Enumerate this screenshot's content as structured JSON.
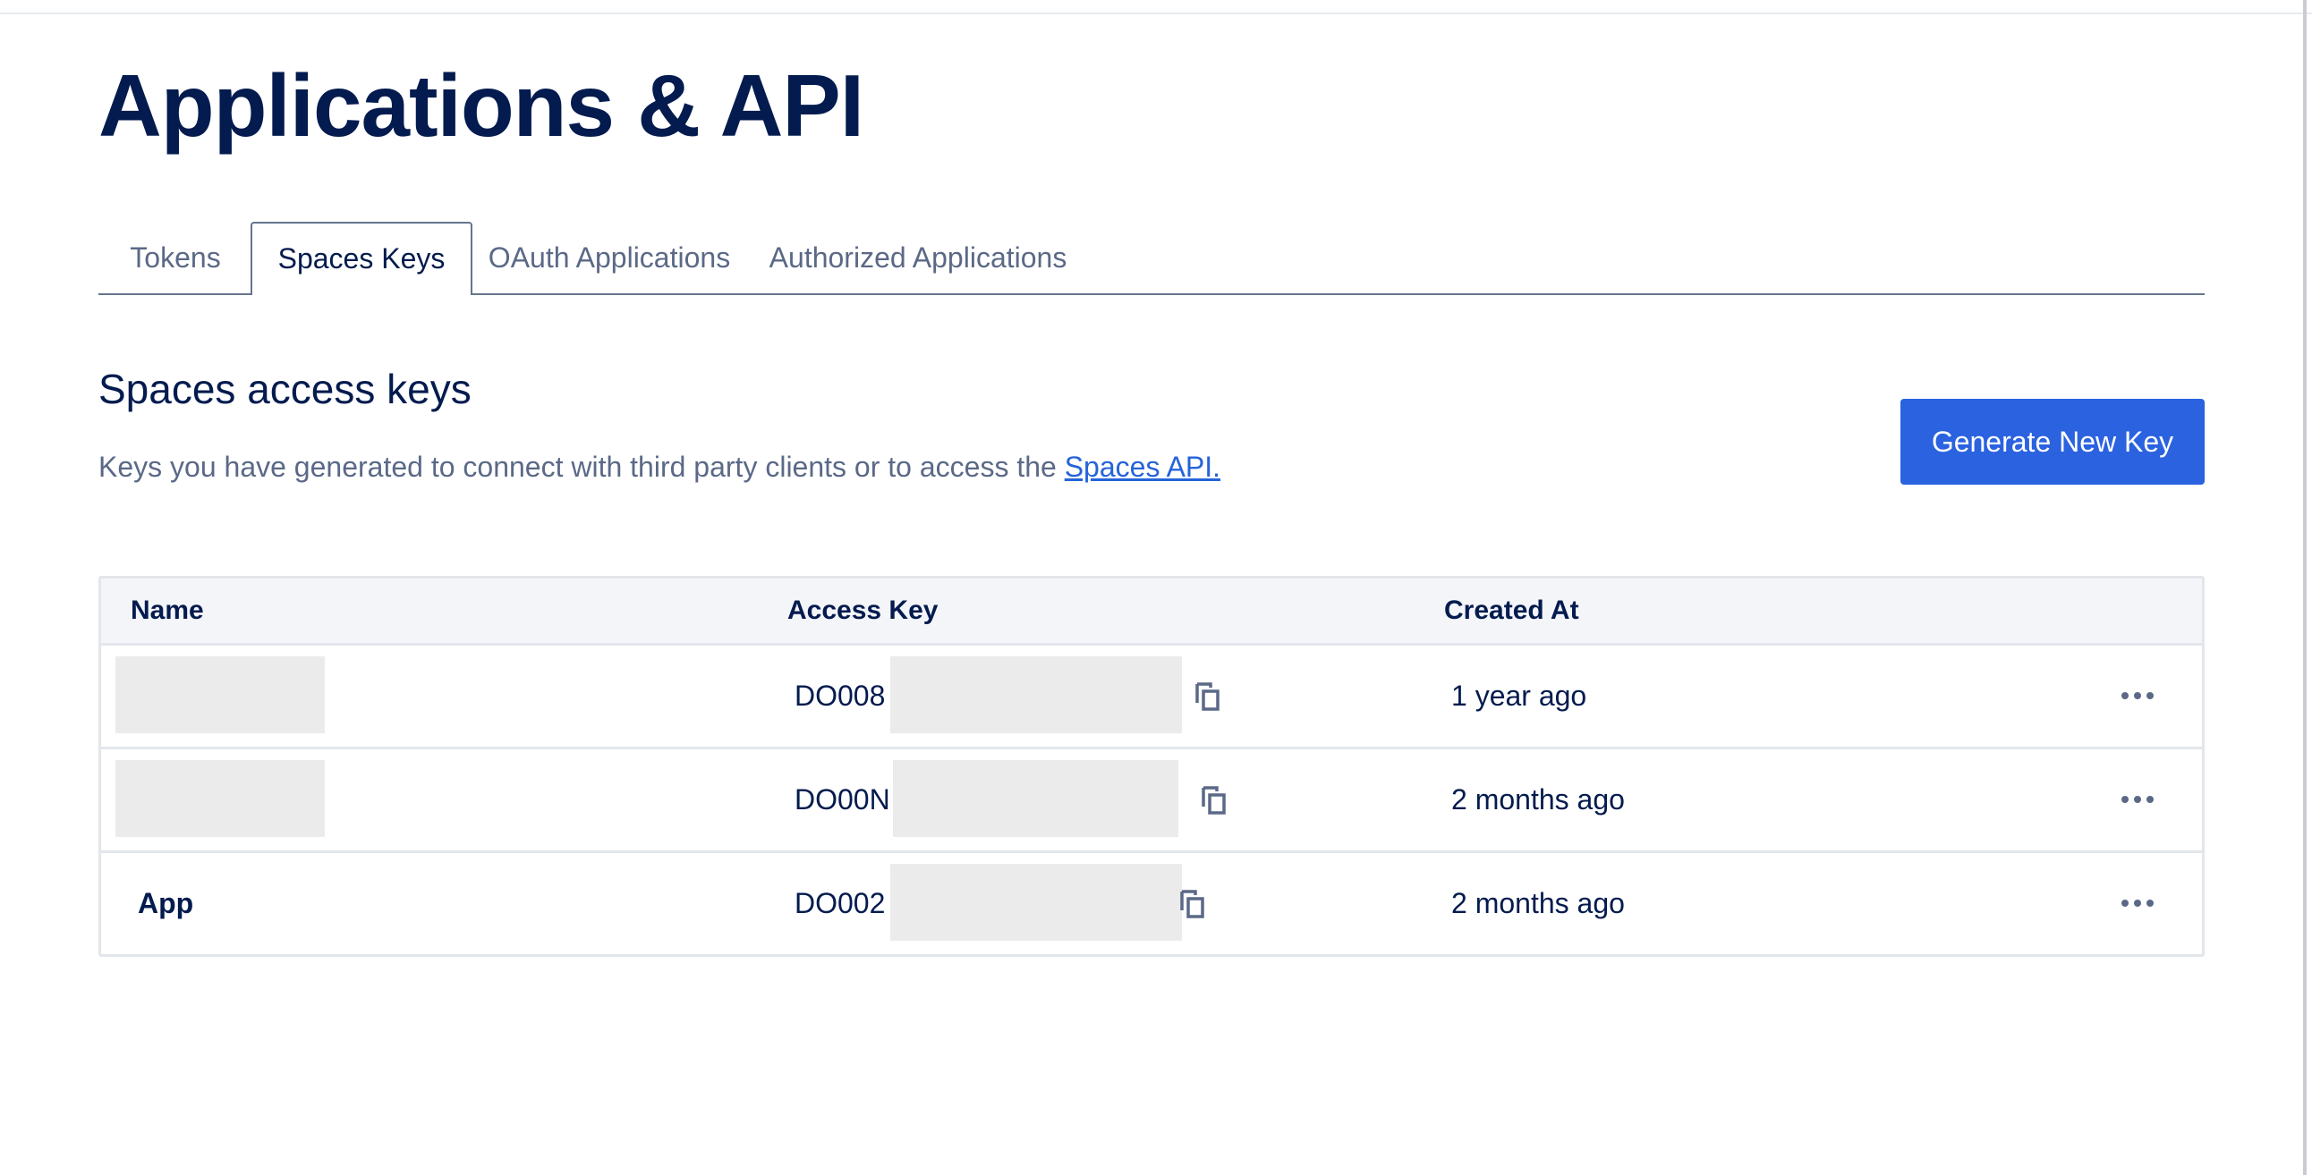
{
  "page": {
    "title": "Applications & API"
  },
  "tabs": [
    {
      "label": "Tokens",
      "active": false
    },
    {
      "label": "Spaces Keys",
      "active": true
    },
    {
      "label": "OAuth Applications",
      "active": false
    },
    {
      "label": "Authorized Applications",
      "active": false
    }
  ],
  "section": {
    "title": "Spaces access keys",
    "description": "Keys you have generated to connect with third party clients or to access the ",
    "link_text": "Spaces API.",
    "generate_button": "Generate New Key"
  },
  "table": {
    "headers": {
      "name": "Name",
      "access_key": "Access Key",
      "created_at": "Created At"
    },
    "rows": [
      {
        "name": "",
        "access_key_prefix": "DO008",
        "created_at": "1 year ago"
      },
      {
        "name": "",
        "access_key_prefix": "DO00N",
        "created_at": "2 months ago"
      },
      {
        "name": "App",
        "access_key_prefix": "DO002",
        "created_at": "2 months ago"
      }
    ]
  },
  "colors": {
    "primary": "#2a62e0",
    "heading": "#031b4e",
    "muted": "#5b6987",
    "link": "#2563d9",
    "redaction": "#ebebeb"
  }
}
